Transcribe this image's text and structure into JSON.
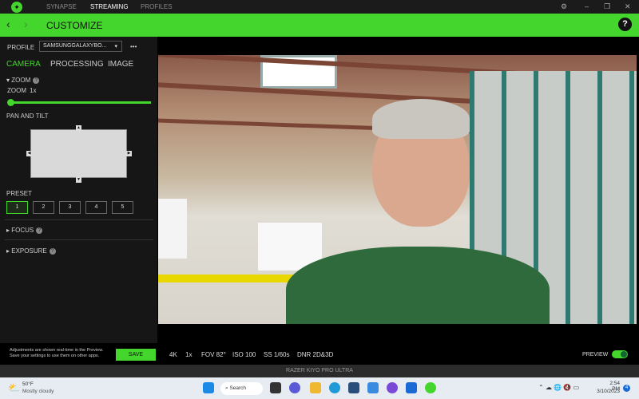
{
  "topnav": {
    "tabs": [
      "SYNAPSE",
      "STREAMING",
      "PROFILES"
    ],
    "active": "STREAMING"
  },
  "header": {
    "title": "CUSTOMIZE",
    "help": "?"
  },
  "profile": {
    "label": "PROFILE",
    "value": "SAMSUNGGALAXYBO...",
    "more": "•••"
  },
  "subtabs": [
    "CAMERA",
    "PROCESSING",
    "IMAGE"
  ],
  "zoom": {
    "section": "ZOOM",
    "label": "ZOOM",
    "value": "1x",
    "level": 0
  },
  "pan": {
    "label": "PAN AND TILT"
  },
  "preset": {
    "label": "PRESET",
    "items": [
      "1",
      "2",
      "3",
      "4",
      "5"
    ],
    "active": "1"
  },
  "sections": {
    "focus": "FOCUS",
    "exposure": "EXPOSURE"
  },
  "footer": {
    "hint1": "Adjustments are shown real-time in the Preview.",
    "hint2": "Save your settings to use them on other apps.",
    "save": "SAVE",
    "stats": [
      "4K",
      "1x",
      "FOV 82°",
      "ISO 100",
      "SS 1/60s",
      "DNR 2D&3D"
    ],
    "preview": "PREVIEW",
    "preview_on": true
  },
  "device": "RAZER KIYO PRO ULTRA",
  "taskbar": {
    "temp": "50°F",
    "weather": "Mostly cloudy",
    "search": "Search",
    "time": "2:54 PM",
    "date": "3/10/2023",
    "badge": "4"
  },
  "colors": {
    "accent": "#44d62c"
  }
}
